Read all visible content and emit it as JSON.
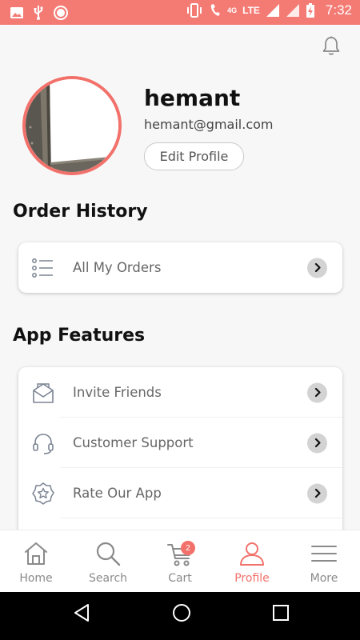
{
  "status_bar": {
    "time": "7:32",
    "network_label": "LTE",
    "network_gen": "4G",
    "background_color": "#f47a74"
  },
  "header": {
    "notification_icon": "bell-icon"
  },
  "profile": {
    "name": "hemant",
    "email": "hemant@gmail.com",
    "edit_label": "Edit Profile",
    "accent_color": "#f2716b"
  },
  "order_history": {
    "title": "Order History",
    "items": [
      {
        "label": "All My Orders",
        "icon": "list-icon"
      }
    ]
  },
  "app_features": {
    "title": "App Features",
    "items": [
      {
        "label": "Invite Friends",
        "icon": "envelope-icon"
      },
      {
        "label": "Customer Support",
        "icon": "headset-icon"
      },
      {
        "label": "Rate Our App",
        "icon": "star-badge-icon"
      }
    ]
  },
  "bottom_nav": {
    "items": [
      {
        "label": "Home",
        "icon": "home-icon"
      },
      {
        "label": "Search",
        "icon": "search-icon"
      },
      {
        "label": "Cart",
        "icon": "cart-icon",
        "badge": "2"
      },
      {
        "label": "Profile",
        "icon": "user-icon",
        "active": true
      },
      {
        "label": "More",
        "icon": "menu-icon"
      }
    ]
  },
  "system_nav": {
    "buttons": [
      "back",
      "home",
      "recents"
    ]
  }
}
